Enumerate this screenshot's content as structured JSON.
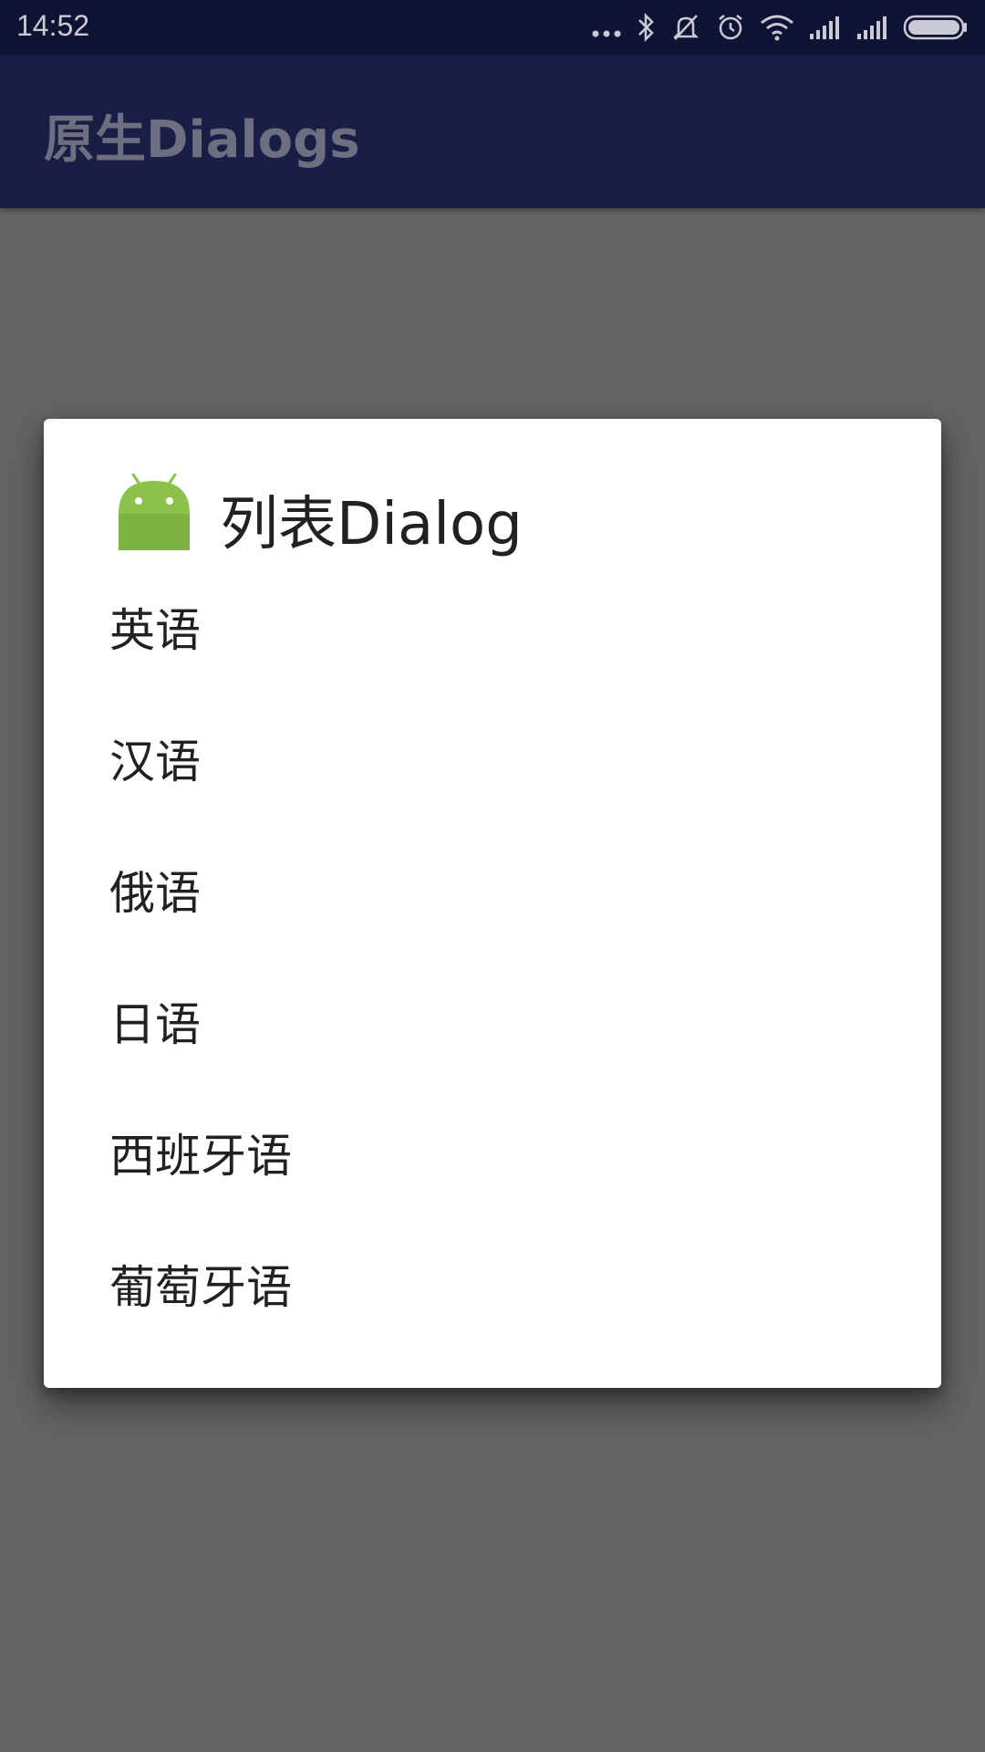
{
  "status_bar": {
    "time": "14:52",
    "icons": [
      "more-dots-icon",
      "bluetooth-icon",
      "mute-icon",
      "alarm-icon",
      "wifi-icon",
      "signal-icon",
      "signal-icon",
      "battery-icon"
    ]
  },
  "app_bar": {
    "title": "原生Dialogs"
  },
  "dialog": {
    "icon": "android-icon",
    "title": "列表Dialog",
    "items": [
      {
        "label": "英语"
      },
      {
        "label": "汉语"
      },
      {
        "label": "俄语"
      },
      {
        "label": "日语"
      },
      {
        "label": "西班牙语"
      },
      {
        "label": "葡萄牙语"
      }
    ]
  },
  "colors": {
    "status_bar": "#101434",
    "app_bar": "#191e47",
    "scrim": "#646464",
    "dialog_bg": "#ffffff",
    "android_green": "#8bc34a"
  }
}
